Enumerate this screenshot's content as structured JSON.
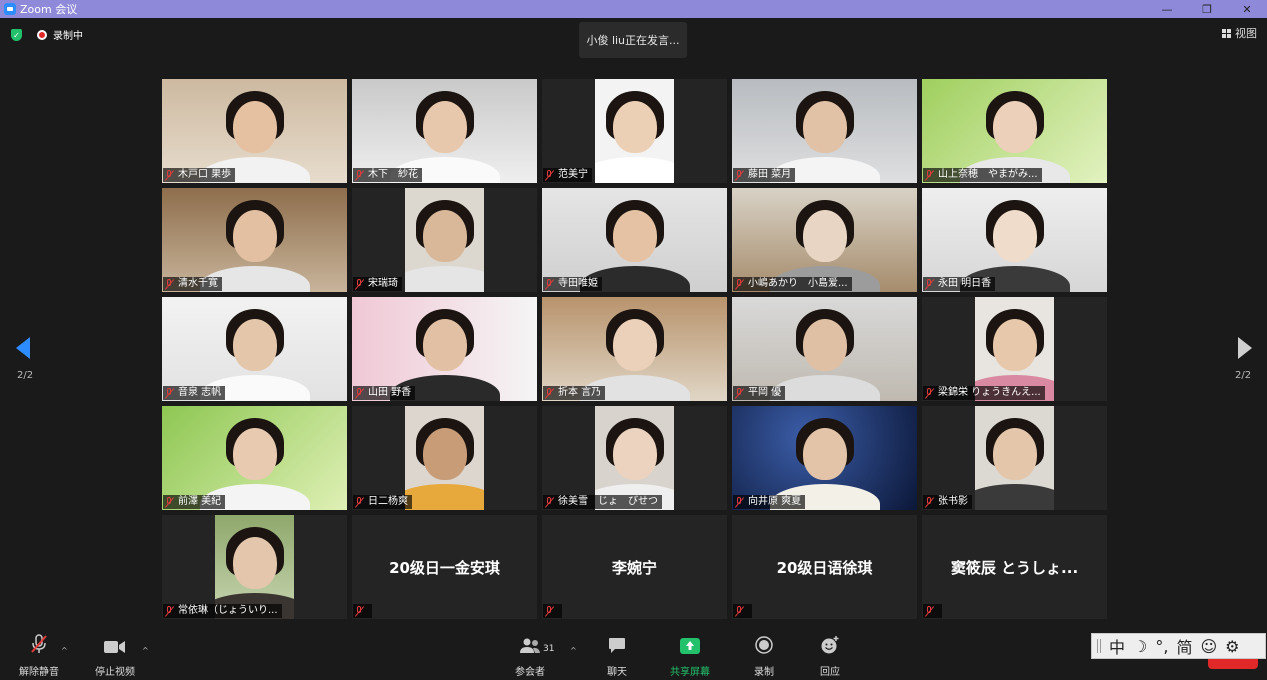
{
  "window": {
    "title": "Zoom 会议",
    "controls": [
      "—",
      "❐",
      "✕"
    ]
  },
  "top": {
    "recording_label": "录制中",
    "speaking_text": "小俊 liu正在发言...",
    "view_label": "视图"
  },
  "pagination": {
    "left": "2/2",
    "right": "2/2"
  },
  "participants": [
    {
      "name": "木戸口 果歩",
      "video": true
    },
    {
      "name": "木下　紗花",
      "video": true
    },
    {
      "name": "范美宁",
      "video": true
    },
    {
      "name": "藤田 菜月",
      "video": true
    },
    {
      "name": "山上奈穂　やまがみ...",
      "video": true
    },
    {
      "name": "清水千寛",
      "video": true
    },
    {
      "name": "宋瑞琦",
      "video": true
    },
    {
      "name": "寺田唯姫",
      "video": true
    },
    {
      "name": "小嶋あかり　小島爱...",
      "video": true
    },
    {
      "name": "永田 明日香",
      "video": true
    },
    {
      "name": "音泉 志帆",
      "video": true
    },
    {
      "name": "山田 野香",
      "video": true
    },
    {
      "name": "折本 言乃",
      "video": true
    },
    {
      "name": "平岡 優",
      "video": true
    },
    {
      "name": "梁錦栄 りょうきんえ...",
      "video": true
    },
    {
      "name": "前澤 美紀",
      "video": true
    },
    {
      "name": "日二杨爽",
      "video": true
    },
    {
      "name": "徐美雪　じょ　びせつ",
      "video": true
    },
    {
      "name": "向井原 爽夏",
      "video": true
    },
    {
      "name": "张书影",
      "video": true
    },
    {
      "name": "常依琳（じょういり...",
      "video": true
    },
    {
      "name": "20级日一金安琪",
      "video": false
    },
    {
      "name": "李婉宁",
      "video": false
    },
    {
      "name": "20级日语徐琪",
      "video": false
    },
    {
      "name": "窦筱辰 とうしょ...",
      "video": false
    }
  ],
  "toolbar": {
    "unmute": "解除静音",
    "stop_video": "停止视频",
    "participants": "参会者",
    "participants_count": "31",
    "chat": "聊天",
    "share": "共享屏幕",
    "record": "录制",
    "reactions": "回应"
  },
  "ime": {
    "items": [
      "中",
      "☽",
      "°,",
      "简",
      "☺",
      "⚙"
    ]
  },
  "colors": {
    "accent": "#2d8cff",
    "share_green": "#23c16b",
    "mute_red": "#e23b3b",
    "titlebar": "#8e8ad9"
  }
}
